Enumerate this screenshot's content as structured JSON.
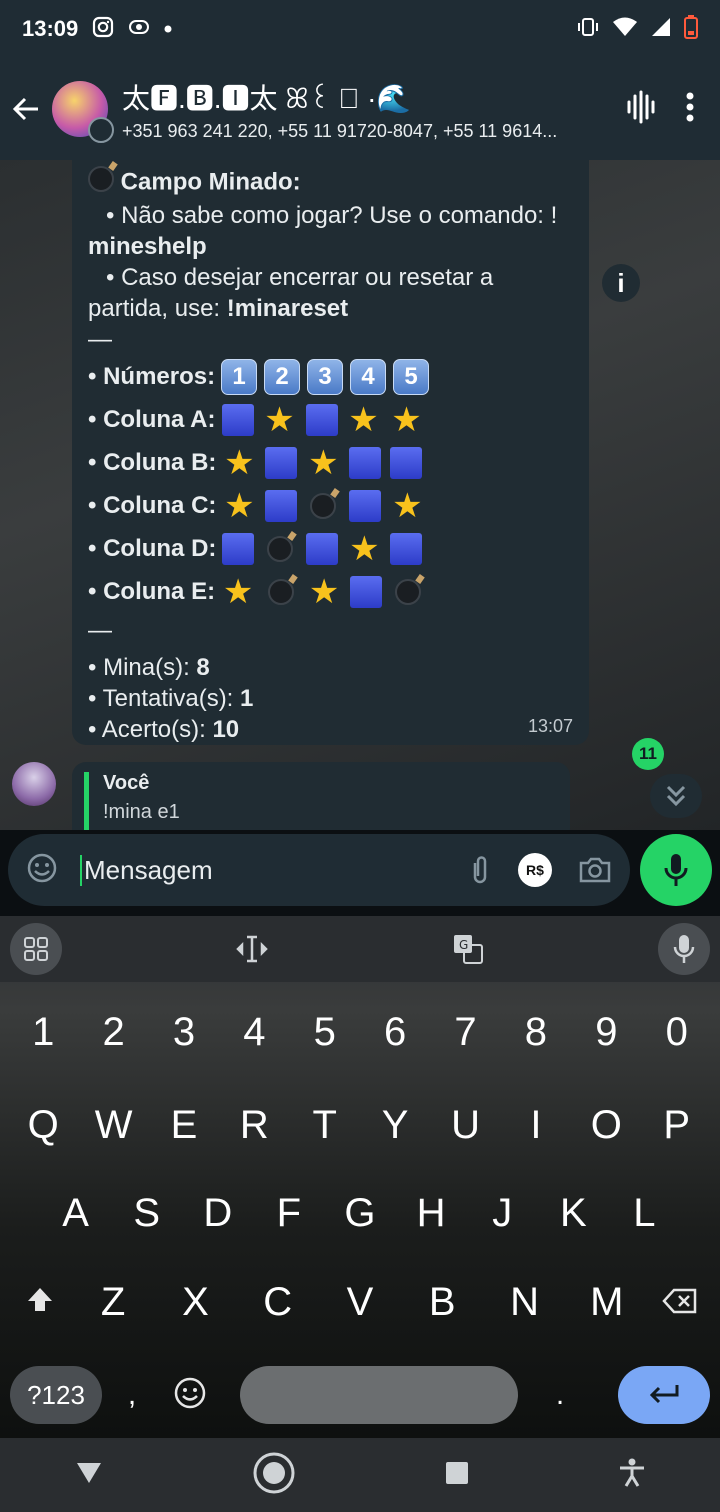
{
  "status_bar": {
    "time": "13:09"
  },
  "header": {
    "title": "太🅵.🅱.🅸太 ꕤ꒰ ⃝ ·🌊",
    "participants": "+351 963 241 220, +55 11 91720-8047, +55 11 9614..."
  },
  "message": {
    "title": "Campo Minado:",
    "help_prefix": "• Não sabe como jogar? Use o comando: !",
    "help_cmd": "mineshelp",
    "reset_prefix": "• Caso desejar encerrar ou resetar a",
    "reset_prefix2": "partida, use: ",
    "reset_cmd": "!minareset",
    "divider": "—",
    "numbers_label": "• Números:",
    "numbers": [
      "1",
      "2",
      "3",
      "4",
      "5"
    ],
    "columns": [
      {
        "label": "• Coluna A:",
        "cells": [
          "square",
          "star",
          "square",
          "star",
          "star"
        ]
      },
      {
        "label": "• Coluna B:",
        "cells": [
          "star",
          "square",
          "star",
          "square",
          "square"
        ]
      },
      {
        "label": "• Coluna C:",
        "cells": [
          "star",
          "square",
          "bomb",
          "square",
          "star"
        ]
      },
      {
        "label": "• Coluna D:",
        "cells": [
          "square",
          "bomb",
          "square",
          "star",
          "square"
        ]
      },
      {
        "label": "• Coluna E:",
        "cells": [
          "star",
          "bomb",
          "star",
          "square",
          "bomb"
        ]
      }
    ],
    "mines_label": "• Mina(s): ",
    "mines_value": "8",
    "attempts_label": "• Tentativa(s): ",
    "attempts_value": "1",
    "hits_label": "• Acerto(s): ",
    "hits_value": "10",
    "time": "13:07"
  },
  "unread_count": "11",
  "reply": {
    "name": "Você",
    "text": "!mina e1"
  },
  "composer": {
    "placeholder": "Mensagem",
    "currency": "R$"
  },
  "keyboard": {
    "numbers": [
      "1",
      "2",
      "3",
      "4",
      "5",
      "6",
      "7",
      "8",
      "9",
      "0"
    ],
    "row1": [
      "Q",
      "W",
      "E",
      "R",
      "T",
      "Y",
      "U",
      "I",
      "O",
      "P"
    ],
    "row2": [
      "A",
      "S",
      "D",
      "F",
      "G",
      "H",
      "J",
      "K",
      "L"
    ],
    "row3": [
      "Z",
      "X",
      "C",
      "V",
      "B",
      "N",
      "M"
    ],
    "symbols_key": "?123",
    "comma": ",",
    "period": "."
  },
  "colors": {
    "accent": "#25d366",
    "bubble": "#202c33",
    "header": "#1f2c34"
  }
}
